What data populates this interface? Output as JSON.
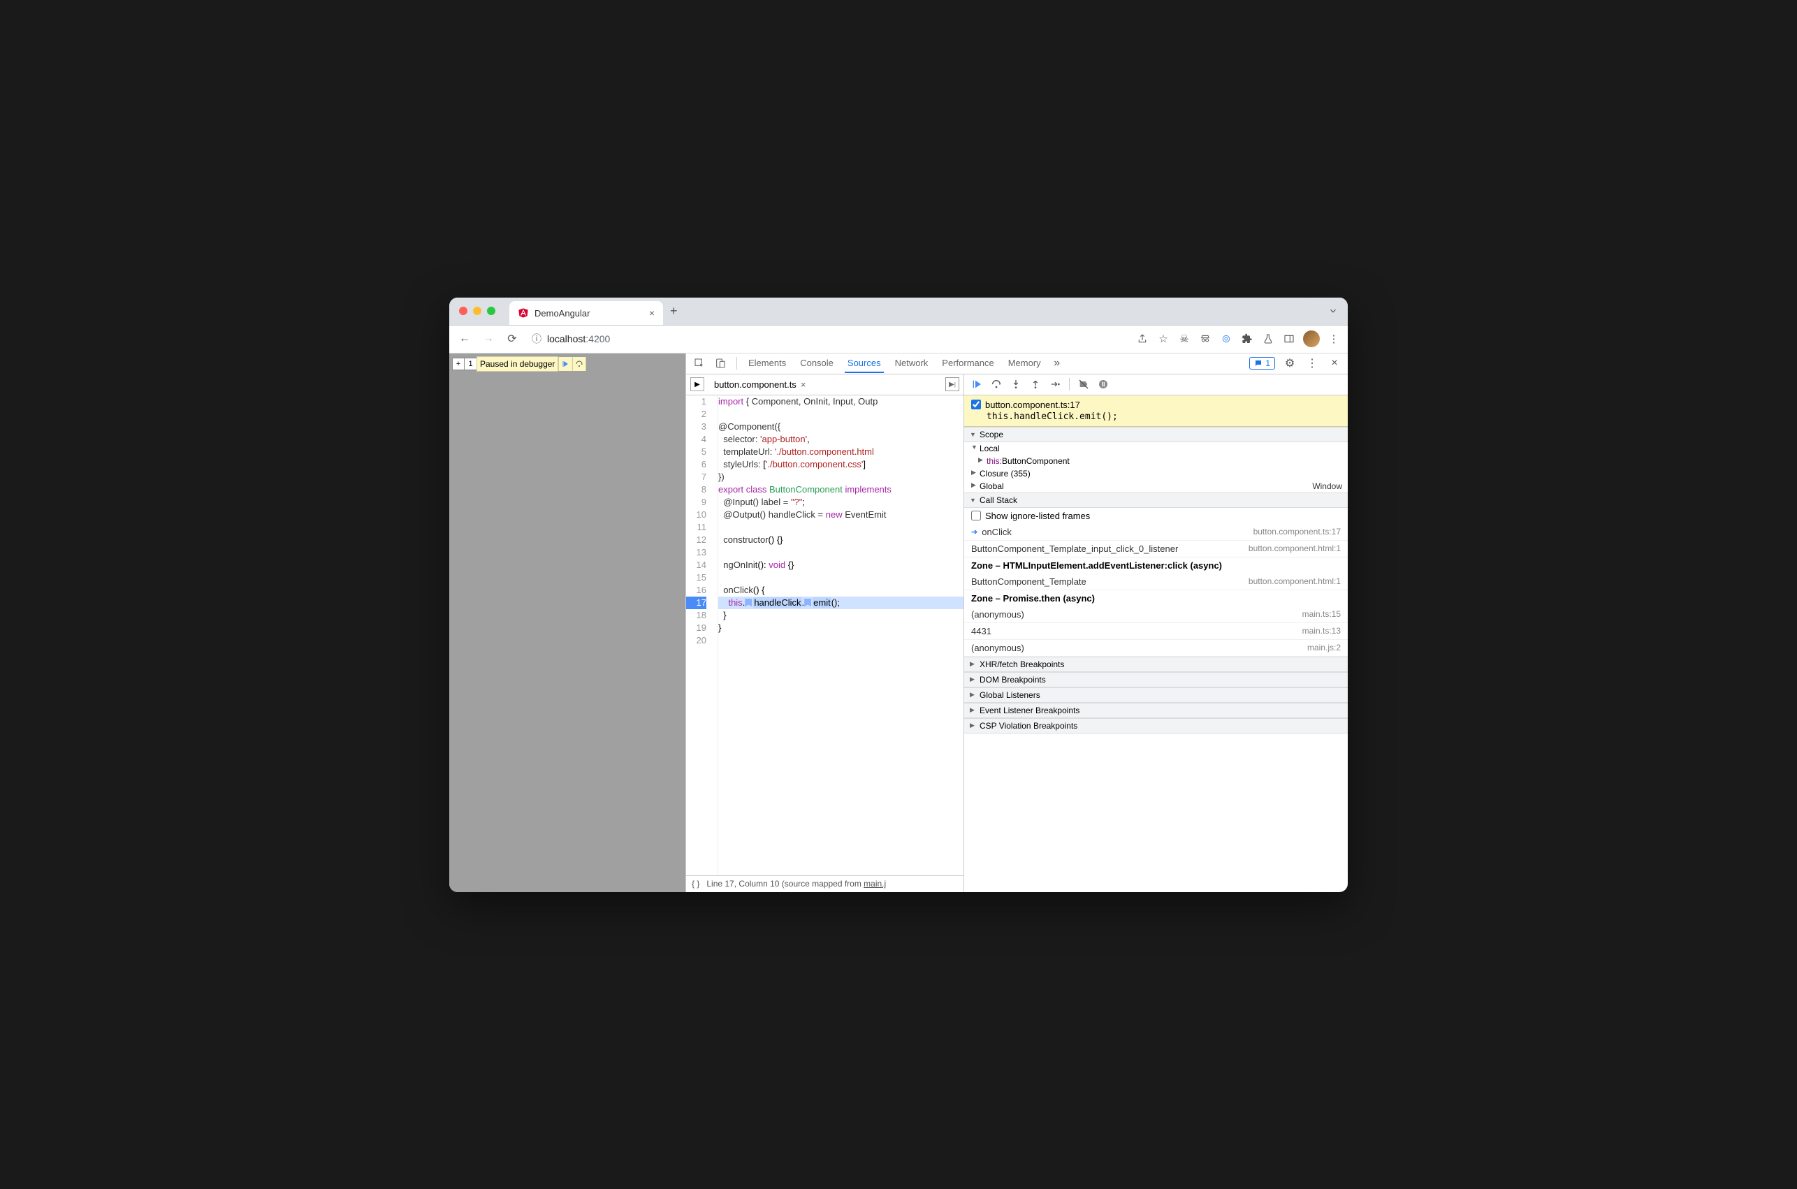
{
  "tab": {
    "title": "DemoAngular"
  },
  "address": {
    "host": "localhost",
    "port": ":4200"
  },
  "paused_label": "Paused in debugger",
  "devtools_tabs": [
    "Elements",
    "Console",
    "Sources",
    "Network",
    "Performance",
    "Memory"
  ],
  "devtools_active_tab": "Sources",
  "issue_count": "1",
  "file_tab": "button.component.ts",
  "code": {
    "lines": [
      {
        "n": 1,
        "html": "<span class='kw'>import</span> <span class='tok'>{ Component, OnInit, Input, Outp</span>"
      },
      {
        "n": 2,
        "html": ""
      },
      {
        "n": 3,
        "html": "<span class='tok'>@Component({</span>"
      },
      {
        "n": 4,
        "html": "  <span class='tok'>selector:</span> <span class='str'>'app-button'</span>,"
      },
      {
        "n": 5,
        "html": "  <span class='tok'>templateUrl:</span> <span class='str'>'./button.component.html</span>"
      },
      {
        "n": 6,
        "html": "  <span class='tok'>styleUrls:</span> [<span class='str'>'./button.component.css'</span>]"
      },
      {
        "n": 7,
        "html": "<span class='tok'>})</span>"
      },
      {
        "n": 8,
        "html": "<span class='kw'>export</span> <span class='kw'>class</span> <span class='cls'>ButtonComponent</span> <span class='kw'>implements</span>"
      },
      {
        "n": 9,
        "html": "  <span class='tok'>@Input() label = </span><span class='str'>\"?\"</span>;"
      },
      {
        "n": 10,
        "html": "  <span class='tok'>@Output() handleClick = </span><span class='kw'>new</span> <span class='fn'>EventEmit</span>"
      },
      {
        "n": 11,
        "html": ""
      },
      {
        "n": 12,
        "html": "  <span class='fn'>constructor</span>() {}"
      },
      {
        "n": 13,
        "html": ""
      },
      {
        "n": 14,
        "html": "  <span class='fn'>ngOnInit</span>(): <span class='kw'>void</span> {}"
      },
      {
        "n": 15,
        "html": ""
      },
      {
        "n": 16,
        "html": "  <span class='fn'>onClick</span>() {"
      },
      {
        "n": 17,
        "html": "    <span class='kw'>this</span>.<span class='bookmark'></span><span class='hl'>handleClick</span>.<span class='bookmark'></span><span class='hl'>emit</span>();",
        "current": true
      },
      {
        "n": 18,
        "html": "  }"
      },
      {
        "n": 19,
        "html": "}"
      },
      {
        "n": 20,
        "html": ""
      }
    ]
  },
  "statusbar": {
    "pos": "Line 17, Column 10",
    "mapped": "(source mapped from ",
    "mapped_link": "main.j"
  },
  "breakpoint": {
    "file": "button.component.ts:17",
    "code": "this.handleClick.emit();"
  },
  "scope": {
    "header": "Scope",
    "local_hdr": "Local",
    "this_label": "this: ",
    "this_val": "ButtonComponent",
    "closure": "Closure (355)",
    "global_label": "Global",
    "global_val": "Window"
  },
  "callstack": {
    "header": "Call Stack",
    "show_ignore": "Show ignore-listed frames",
    "frames": [
      {
        "name": "onClick",
        "loc": "button.component.ts:17",
        "current": true
      },
      {
        "name": "ButtonComponent_Template_input_click_0_listener",
        "loc": "button.component.html:1"
      },
      {
        "zone": "Zone – HTMLInputElement.addEventListener:click (async)"
      },
      {
        "name": "ButtonComponent_Template",
        "loc": "button.component.html:1"
      },
      {
        "zone": "Zone – Promise.then (async)"
      },
      {
        "name": "(anonymous)",
        "loc": "main.ts:15"
      },
      {
        "name": "4431",
        "loc": "main.ts:13"
      },
      {
        "name": "(anonymous)",
        "loc": "main.js:2"
      }
    ]
  },
  "collapsed_sections": [
    "XHR/fetch Breakpoints",
    "DOM Breakpoints",
    "Global Listeners",
    "Event Listener Breakpoints",
    "CSP Violation Breakpoints"
  ]
}
